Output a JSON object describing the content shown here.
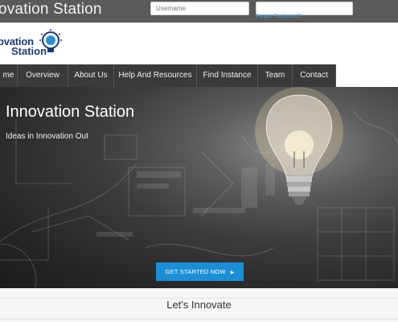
{
  "topbar": {
    "brand": "ovation Station",
    "username_placeholder": "Username",
    "forgot_password": "Forgot Password?"
  },
  "logo": {
    "line1": "ovation",
    "line2": "Station",
    "icon": "lightbulb-icon",
    "color": "#1a3a78"
  },
  "nav": {
    "items": [
      {
        "label": "me"
      },
      {
        "label": "Overview"
      },
      {
        "label": "About Us"
      },
      {
        "label": "Help And Resources"
      },
      {
        "label": "Find Instance"
      },
      {
        "label": "Team"
      },
      {
        "label": "Contact"
      }
    ]
  },
  "hero": {
    "title": "Innovation Station",
    "subtitle": "Ideas in Innovation Out",
    "cta_label": "GET STARTED NOW",
    "cta_arrow": "▶",
    "cta_color": "#1a8fd6"
  },
  "section": {
    "title": "Let's Innovate"
  }
}
